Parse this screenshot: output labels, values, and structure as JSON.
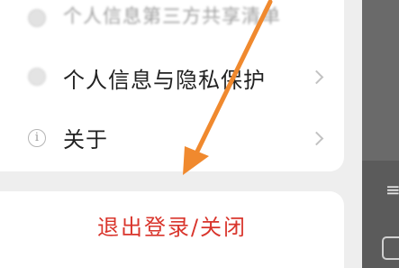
{
  "menu": {
    "items": [
      {
        "label": "个人信息第三方共享清单",
        "icon": "list-icon"
      },
      {
        "label": "个人信息与隐私保护",
        "icon": "privacy-icon"
      },
      {
        "label": "关于",
        "icon": "info-icon"
      }
    ]
  },
  "logout": {
    "label": "退出登录/关闭"
  },
  "side_panel": {
    "glyph": "≡"
  },
  "colors": {
    "logout_text": "#d9352c",
    "arrow": "#f0892e",
    "background": "#eeeeee"
  }
}
